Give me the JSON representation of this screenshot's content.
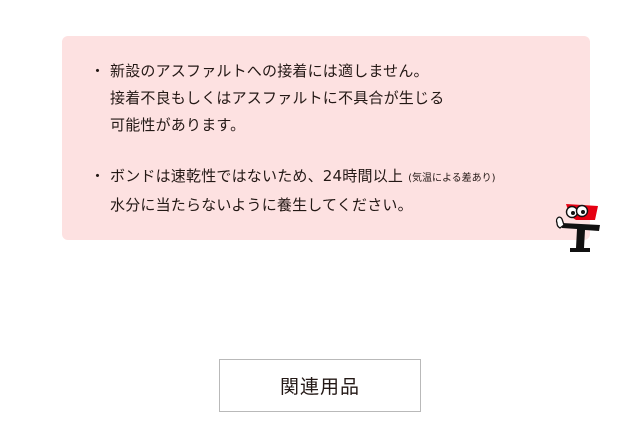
{
  "notice": {
    "items": [
      {
        "bullet": "・",
        "lines": [
          "新設のアスファルトへの接着には適しません。",
          "接着不良もしくはアスファルトに不具合が生じる",
          "可能性があります。"
        ]
      },
      {
        "bullet": "・",
        "line1_main": "ボンドは速乾性ではないため、24時間以上",
        "line1_small": "(気温による差あり)",
        "line2": "水分に当たらないように養生してください。"
      }
    ]
  },
  "mascot_icon": "mascot-character-icon",
  "colors": {
    "notice_background": "#fde1e1",
    "mascot_red": "#e60012",
    "text": "#231815"
  },
  "related_button": {
    "label": "関連用品"
  }
}
